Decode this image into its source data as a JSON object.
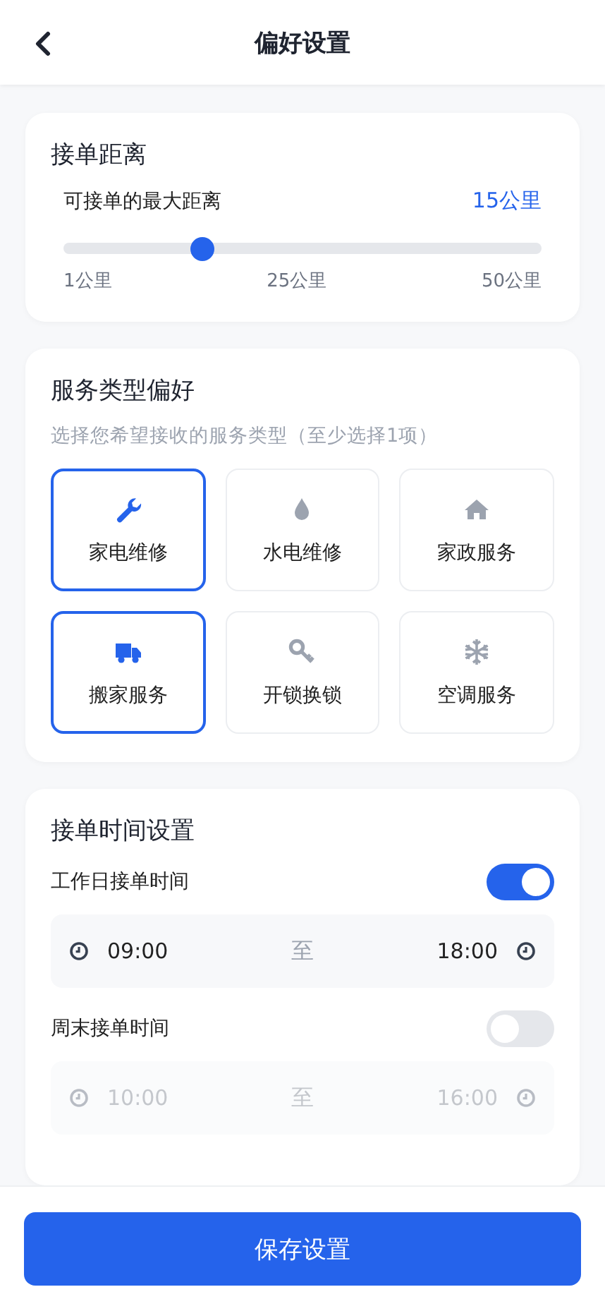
{
  "header": {
    "title": "偏好设置"
  },
  "distance": {
    "title": "接单距离",
    "label": "可接单的最大距离",
    "value": "15公里",
    "level": 0.29,
    "ticks": [
      "1公里",
      "25公里",
      "50公里"
    ]
  },
  "services": {
    "title": "服务类型偏好",
    "hint": "选择您希望接收的服务类型（至少选择1项）",
    "items": [
      {
        "kind": "wrench",
        "label": "家电维修",
        "selected": true
      },
      {
        "kind": "drop",
        "label": "水电维修",
        "selected": false
      },
      {
        "kind": "house",
        "label": "家政服务",
        "selected": false
      },
      {
        "kind": "truck",
        "label": "搬家服务",
        "selected": true
      },
      {
        "kind": "key",
        "label": "开锁换锁",
        "selected": false
      },
      {
        "kind": "snowflake",
        "label": "空调服务",
        "selected": false
      }
    ]
  },
  "schedule": {
    "title": "接单时间设置",
    "periods": [
      {
        "label": "工作日接单时间",
        "on": true,
        "start": "09:00",
        "separator": "至",
        "end": "18:00"
      },
      {
        "label": "周末接单时间",
        "on": false,
        "start": "10:00",
        "separator": "至",
        "end": "16:00"
      }
    ]
  },
  "save_button": "保存设置"
}
